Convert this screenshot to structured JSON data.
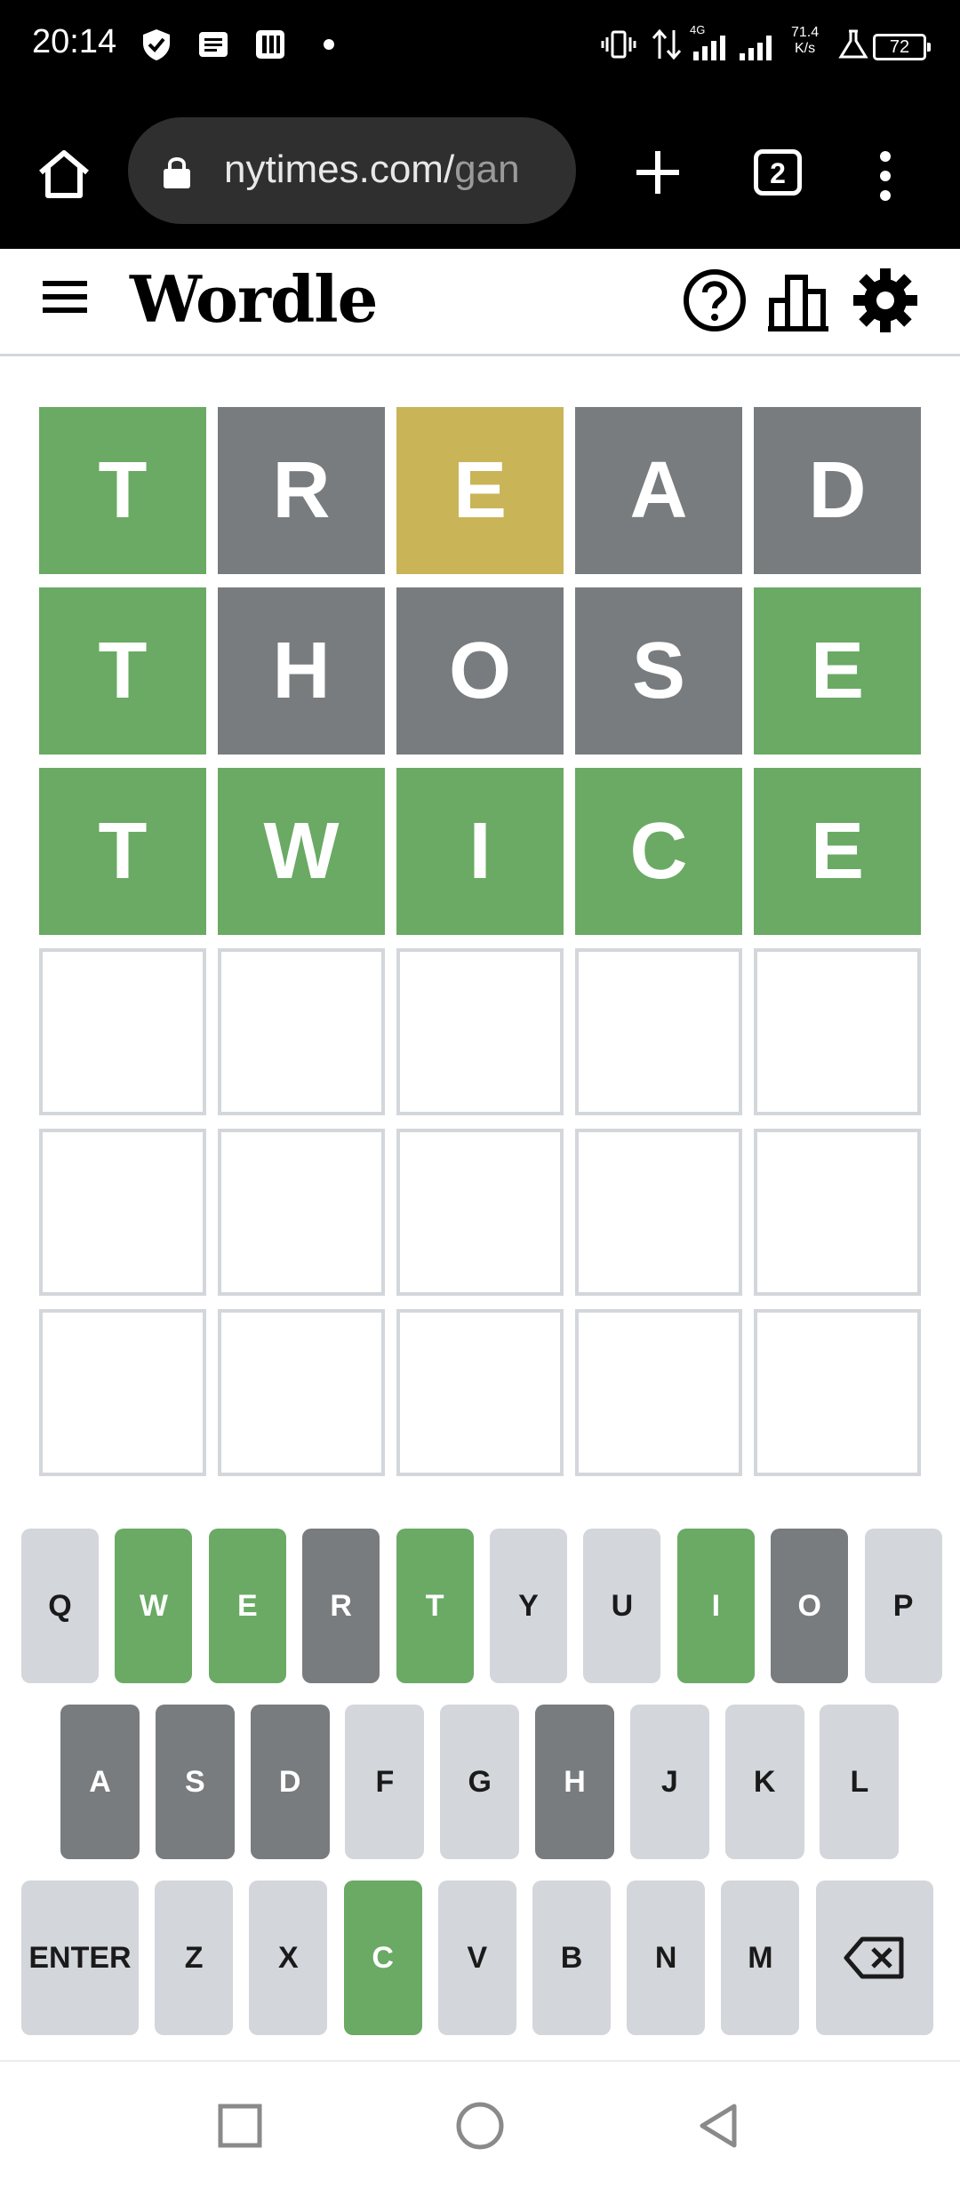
{
  "status_bar": {
    "time": "20:14",
    "network_speed_value": "71.4",
    "network_speed_unit": "K/s",
    "network_type": "4G",
    "battery": "72"
  },
  "browser": {
    "url_main": "nytimes.com/",
    "url_rest": "gan",
    "tab_count": "2"
  },
  "app": {
    "title": "Wordle"
  },
  "board": {
    "rows": [
      {
        "tiles": [
          {
            "letter": "T",
            "state": "correct"
          },
          {
            "letter": "R",
            "state": "absent"
          },
          {
            "letter": "E",
            "state": "present"
          },
          {
            "letter": "A",
            "state": "absent"
          },
          {
            "letter": "D",
            "state": "absent"
          }
        ]
      },
      {
        "tiles": [
          {
            "letter": "T",
            "state": "correct"
          },
          {
            "letter": "H",
            "state": "absent"
          },
          {
            "letter": "O",
            "state": "absent"
          },
          {
            "letter": "S",
            "state": "absent"
          },
          {
            "letter": "E",
            "state": "correct"
          }
        ]
      },
      {
        "tiles": [
          {
            "letter": "T",
            "state": "correct"
          },
          {
            "letter": "W",
            "state": "correct"
          },
          {
            "letter": "I",
            "state": "correct"
          },
          {
            "letter": "C",
            "state": "correct"
          },
          {
            "letter": "E",
            "state": "correct"
          }
        ]
      },
      {
        "tiles": [
          {
            "letter": "",
            "state": "empty"
          },
          {
            "letter": "",
            "state": "empty"
          },
          {
            "letter": "",
            "state": "empty"
          },
          {
            "letter": "",
            "state": "empty"
          },
          {
            "letter": "",
            "state": "empty"
          }
        ]
      },
      {
        "tiles": [
          {
            "letter": "",
            "state": "empty"
          },
          {
            "letter": "",
            "state": "empty"
          },
          {
            "letter": "",
            "state": "empty"
          },
          {
            "letter": "",
            "state": "empty"
          },
          {
            "letter": "",
            "state": "empty"
          }
        ]
      },
      {
        "tiles": [
          {
            "letter": "",
            "state": "empty"
          },
          {
            "letter": "",
            "state": "empty"
          },
          {
            "letter": "",
            "state": "empty"
          },
          {
            "letter": "",
            "state": "empty"
          },
          {
            "letter": "",
            "state": "empty"
          }
        ]
      }
    ]
  },
  "keyboard": {
    "rows": [
      [
        {
          "label": "Q",
          "state": "unused"
        },
        {
          "label": "W",
          "state": "correct"
        },
        {
          "label": "E",
          "state": "correct"
        },
        {
          "label": "R",
          "state": "absent"
        },
        {
          "label": "T",
          "state": "correct"
        },
        {
          "label": "Y",
          "state": "unused"
        },
        {
          "label": "U",
          "state": "unused"
        },
        {
          "label": "I",
          "state": "correct"
        },
        {
          "label": "O",
          "state": "absent"
        },
        {
          "label": "P",
          "state": "unused"
        }
      ],
      [
        {
          "label": "A",
          "state": "absent"
        },
        {
          "label": "S",
          "state": "absent"
        },
        {
          "label": "D",
          "state": "absent"
        },
        {
          "label": "F",
          "state": "unused"
        },
        {
          "label": "G",
          "state": "unused"
        },
        {
          "label": "H",
          "state": "absent"
        },
        {
          "label": "J",
          "state": "unused"
        },
        {
          "label": "K",
          "state": "unused"
        },
        {
          "label": "L",
          "state": "unused"
        }
      ],
      [
        {
          "label": "ENTER",
          "state": "unused",
          "wide": true
        },
        {
          "label": "Z",
          "state": "unused"
        },
        {
          "label": "X",
          "state": "unused"
        },
        {
          "label": "C",
          "state": "correct"
        },
        {
          "label": "V",
          "state": "unused"
        },
        {
          "label": "B",
          "state": "unused"
        },
        {
          "label": "N",
          "state": "unused"
        },
        {
          "label": "M",
          "state": "unused"
        },
        {
          "label": "",
          "state": "unused",
          "wide": true,
          "icon": "backspace-icon"
        }
      ]
    ]
  },
  "colors": {
    "correct": "#6aaa64",
    "present": "#c9b458",
    "absent": "#787c7e",
    "key_unused": "#d3d6da",
    "empty_border": "#d3d6da"
  }
}
